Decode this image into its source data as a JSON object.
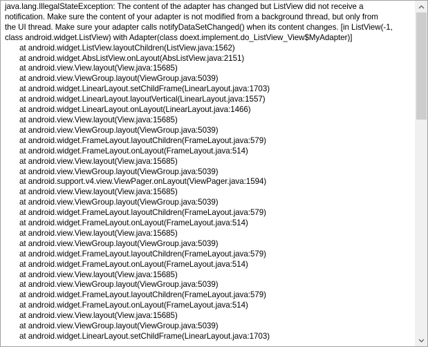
{
  "log": {
    "header": [
      "java.lang.IllegalStateException: The content of the adapter has changed but ListView did not receive a",
      "notification. Make sure the content of your adapter is not modified from a background thread, but only from",
      "the UI thread. Make sure your adapter calls notifyDataSetChanged() when its content changes. [in ListView(-1,",
      "class android.widget.ListView) with Adapter(class doext.implement.do_ListView_View$MyAdapter)]"
    ],
    "trace": [
      "at android.widget.ListView.layoutChildren(ListView.java:1562)",
      "at android.widget.AbsListView.onLayout(AbsListView.java:2151)",
      "at android.view.View.layout(View.java:15685)",
      "at android.view.ViewGroup.layout(ViewGroup.java:5039)",
      "at android.widget.LinearLayout.setChildFrame(LinearLayout.java:1703)",
      "at android.widget.LinearLayout.layoutVertical(LinearLayout.java:1557)",
      "at android.widget.LinearLayout.onLayout(LinearLayout.java:1466)",
      "at android.view.View.layout(View.java:15685)",
      "at android.view.ViewGroup.layout(ViewGroup.java:5039)",
      "at android.widget.FrameLayout.layoutChildren(FrameLayout.java:579)",
      "at android.widget.FrameLayout.onLayout(FrameLayout.java:514)",
      "at android.view.View.layout(View.java:15685)",
      "at android.view.ViewGroup.layout(ViewGroup.java:5039)",
      "at android.support.v4.view.ViewPager.onLayout(ViewPager.java:1594)",
      "at android.view.View.layout(View.java:15685)",
      "at android.view.ViewGroup.layout(ViewGroup.java:5039)",
      "at android.widget.FrameLayout.layoutChildren(FrameLayout.java:579)",
      "at android.widget.FrameLayout.onLayout(FrameLayout.java:514)",
      "at android.view.View.layout(View.java:15685)",
      "at android.view.ViewGroup.layout(ViewGroup.java:5039)",
      "at android.widget.FrameLayout.layoutChildren(FrameLayout.java:579)",
      "at android.widget.FrameLayout.onLayout(FrameLayout.java:514)",
      "at android.view.View.layout(View.java:15685)",
      "at android.view.ViewGroup.layout(ViewGroup.java:5039)",
      "at android.widget.FrameLayout.layoutChildren(FrameLayout.java:579)",
      "at android.widget.FrameLayout.onLayout(FrameLayout.java:514)",
      "at android.view.View.layout(View.java:15685)",
      "at android.view.ViewGroup.layout(ViewGroup.java:5039)",
      "at android.widget.LinearLayout.setChildFrame(LinearLayout.java:1703)"
    ]
  },
  "scrollbar": {
    "up_icon": "chevron-up-icon",
    "down_icon": "chevron-down-icon",
    "track_color": "#f0f0f0",
    "thumb_color": "#cdcdcd",
    "arrow_color": "#606060"
  }
}
